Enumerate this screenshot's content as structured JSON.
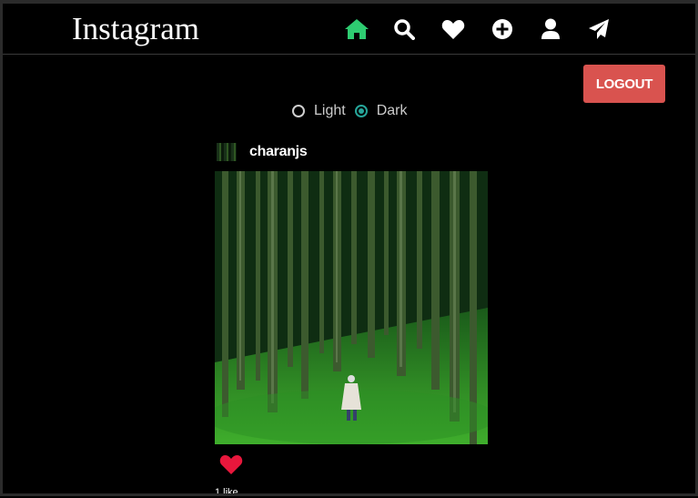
{
  "brand": "Instagram",
  "nav": {
    "icons": [
      "home-icon",
      "search-icon",
      "heart-icon",
      "plus-circle-icon",
      "user-icon",
      "paper-plane-icon"
    ],
    "active_color": "#2ecc71"
  },
  "logout_label": "LOGOUT",
  "theme": {
    "options": [
      "Light",
      "Dark"
    ],
    "selected": "Dark"
  },
  "post": {
    "username": "charanjs",
    "likes_text": "1 like"
  },
  "colors": {
    "logout_bg": "#d9534f",
    "like_heart": "#e8173c",
    "radio_accent": "#26a69a"
  }
}
